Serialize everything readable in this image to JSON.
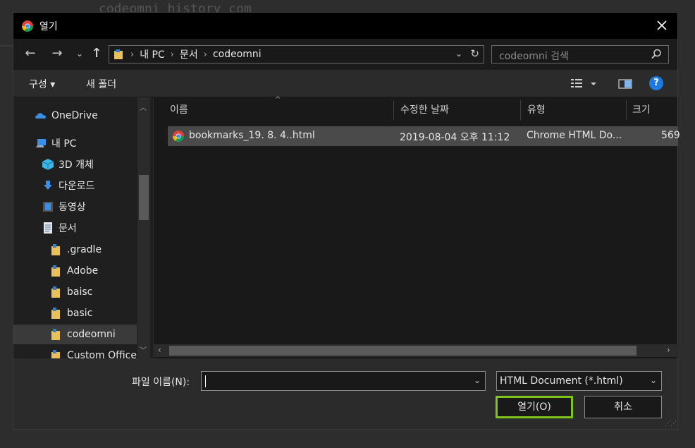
{
  "background": {
    "text": "codeomni history com"
  },
  "dialog": {
    "title": "열기",
    "address": {
      "crumbs": [
        "내 PC",
        "문서",
        "codeomni"
      ]
    },
    "search": {
      "placeholder": "codeomni 검색"
    },
    "toolbar": {
      "organize": "구성 ▾",
      "new_folder": "새 폴더",
      "help": "?"
    },
    "nav": {
      "items": [
        {
          "label": "OneDrive",
          "icon": "onedrive-icon"
        },
        {
          "label": "내 PC",
          "icon": "pc-icon"
        },
        {
          "label": "3D 개체",
          "icon": "3d-objects-icon"
        },
        {
          "label": "다운로드",
          "icon": "download-icon"
        },
        {
          "label": "동영상",
          "icon": "video-icon"
        },
        {
          "label": "문서",
          "icon": "document-icon"
        },
        {
          "label": ".gradle",
          "icon": "folder-icon"
        },
        {
          "label": "Adobe",
          "icon": "folder-icon"
        },
        {
          "label": "baisc",
          "icon": "folder-icon"
        },
        {
          "label": "basic",
          "icon": "folder-icon"
        },
        {
          "label": "codeomni",
          "icon": "folder-icon",
          "selected": true
        },
        {
          "label": "Custom Office",
          "icon": "folder-icon"
        }
      ]
    },
    "columns": {
      "name": "이름",
      "modified": "수정한 날짜",
      "type": "유형",
      "size": "크기"
    },
    "files": [
      {
        "name": "bookmarks_19. 8. 4..html",
        "modified": "2019-08-04 오후 11:12",
        "type": "Chrome HTML Do...",
        "size": "569",
        "icon": "chrome-icon"
      }
    ],
    "footer": {
      "filename_label": "파일 이름(N):",
      "filename_value": "",
      "filetype": "HTML Document (*.html)",
      "open_label": "열기(O)",
      "cancel_label": "취소"
    },
    "colors": {
      "accent": "#7dc51c",
      "help": "#1f7ae0"
    }
  }
}
